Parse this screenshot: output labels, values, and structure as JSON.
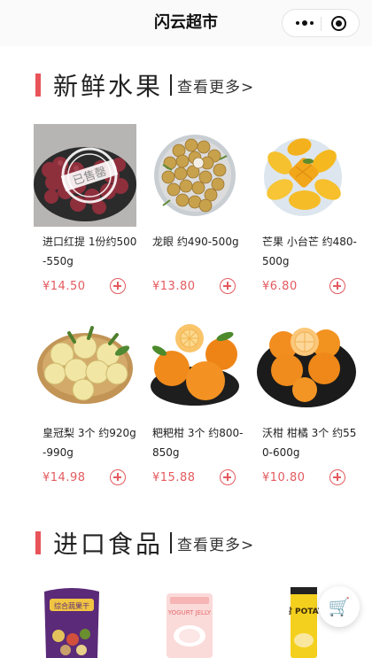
{
  "nav": {
    "title": "闪云超市"
  },
  "sections": [
    {
      "title": "新鲜水果",
      "more": "查看更多>"
    },
    {
      "title": "进口食品",
      "more": "查看更多>"
    }
  ],
  "fruits": [
    {
      "name": "进口红提 1份约500-550g",
      "price": "¥14.50",
      "stamp": "已售罄"
    },
    {
      "name": "龙眼 约490-500g",
      "price": "¥13.80"
    },
    {
      "name": "芒果 小台芒 约480-500g",
      "price": "¥6.80"
    },
    {
      "name": "皇冠梨 3个 约920g-990g",
      "price": "¥14.98"
    },
    {
      "name": "粑粑柑 3个 约800-850g",
      "price": "¥15.88"
    },
    {
      "name": "沃柑 柑橘 3个 约550-600g",
      "price": "¥10.80"
    }
  ],
  "imports": [
    {
      "label": "综合蔬果干"
    },
    {
      "label": "YOGURT JELLY"
    },
    {
      "label": "예감 POTATO"
    }
  ],
  "colors": {
    "accent": "#e8545a",
    "price": "#e35a5f"
  }
}
